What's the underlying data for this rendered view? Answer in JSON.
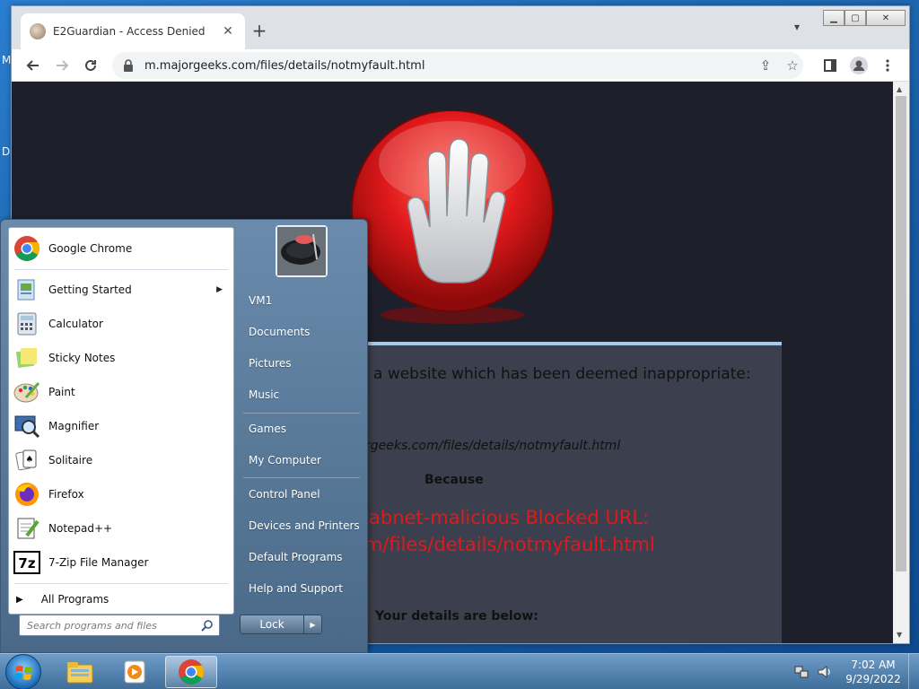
{
  "desktop": {
    "fragments": [
      "M",
      "D"
    ]
  },
  "browser": {
    "tab_title": "E2Guardian - Access Denied",
    "url": "m.majorgeeks.com/files/details/notmyfault.html"
  },
  "blockpage": {
    "line1": "a website which has been deemed inappropriate:",
    "line2": "rgeeks.com/files/details/notmyfault.html",
    "because": "Because",
    "reason1": "abnet-malicious  Blocked URL:",
    "reason2": "om/files/details/notmyfault.html",
    "details": "Your details are below:"
  },
  "start_menu": {
    "programs": [
      {
        "label": "Google Chrome",
        "icon": "chrome-icon"
      },
      {
        "label": "Getting Started",
        "icon": "getting-started-icon",
        "submenu": true
      },
      {
        "label": "Calculator",
        "icon": "calculator-icon"
      },
      {
        "label": "Sticky Notes",
        "icon": "sticky-notes-icon"
      },
      {
        "label": "Paint",
        "icon": "paint-icon"
      },
      {
        "label": "Magnifier",
        "icon": "magnifier-icon"
      },
      {
        "label": "Solitaire",
        "icon": "solitaire-icon"
      },
      {
        "label": "Firefox",
        "icon": "firefox-icon"
      },
      {
        "label": "Notepad++",
        "icon": "notepadpp-icon"
      },
      {
        "label": "7-Zip File Manager",
        "icon": "7zip-icon"
      }
    ],
    "all_programs": "All Programs",
    "search_placeholder": "Search programs and files",
    "right_items": [
      "VM1",
      "Documents",
      "Pictures",
      "Music",
      "Games",
      "My Computer",
      "Control Panel",
      "Devices and Printers",
      "Default Programs",
      "Help and Support"
    ],
    "lock_label": "Lock"
  },
  "tray": {
    "time": "7:02 AM",
    "date": "9/29/2022"
  },
  "colors": {
    "page_bg": "#1d1f2b",
    "panel_bg": "#3c3f4d",
    "alert_red": "#e0191b",
    "accent_blue": "#a9c9ea"
  }
}
